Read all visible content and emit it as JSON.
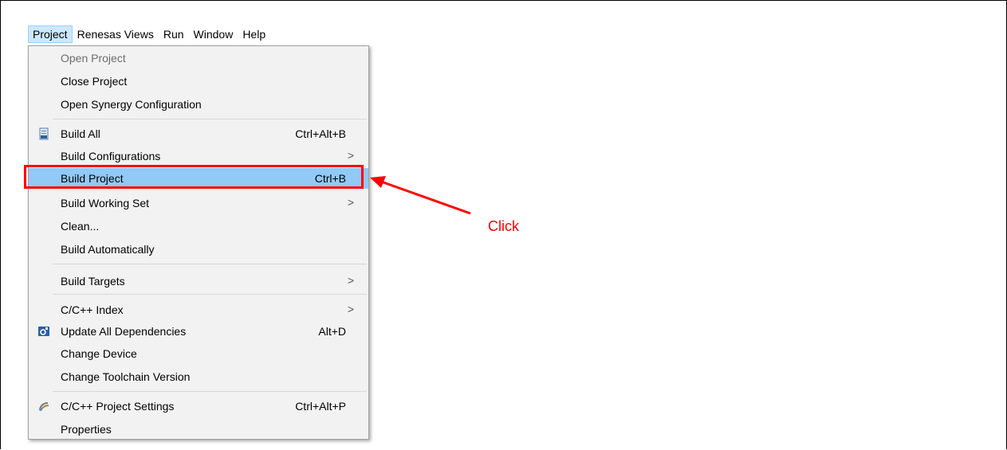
{
  "menubar": {
    "items": [
      {
        "label": "Project",
        "active": true
      },
      {
        "label": "Renesas Views"
      },
      {
        "label": "Run"
      },
      {
        "label": "Window"
      },
      {
        "label": "Help"
      }
    ]
  },
  "menu": {
    "open_project": {
      "label": "Open Project"
    },
    "close_project": {
      "label": "Close Project"
    },
    "open_synergy": {
      "label": "Open Synergy Configuration"
    },
    "build_all": {
      "label": "Build All",
      "shortcut": "Ctrl+Alt+B",
      "icon": "build-all-icon"
    },
    "build_configurations": {
      "label": "Build Configurations",
      "submenu": ">"
    },
    "build_project": {
      "label": "Build Project",
      "shortcut": "Ctrl+B"
    },
    "build_working_set": {
      "label": "Build Working Set",
      "submenu": ">"
    },
    "clean": {
      "label": "Clean..."
    },
    "build_automatically": {
      "label": "Build Automatically"
    },
    "build_targets": {
      "label": "Build Targets",
      "submenu": ">"
    },
    "cpp_index": {
      "label": "C/C++ Index",
      "submenu": ">"
    },
    "update_deps": {
      "label": "Update All Dependencies",
      "shortcut": "Alt+D",
      "icon": "e2-studio-icon"
    },
    "change_device": {
      "label": "Change Device"
    },
    "change_toolchain": {
      "label": "Change Toolchain Version"
    },
    "project_settings": {
      "label": "C/C++ Project Settings",
      "shortcut": "Ctrl+Alt+P",
      "icon": "settings-icon"
    },
    "properties": {
      "label": "Properties"
    }
  },
  "annotation": {
    "text": "Click",
    "color": "#ff0000"
  },
  "colors": {
    "selected": "#91c9f7",
    "menu_bg": "#f2f2f2",
    "accent_red": "#ff0000"
  }
}
